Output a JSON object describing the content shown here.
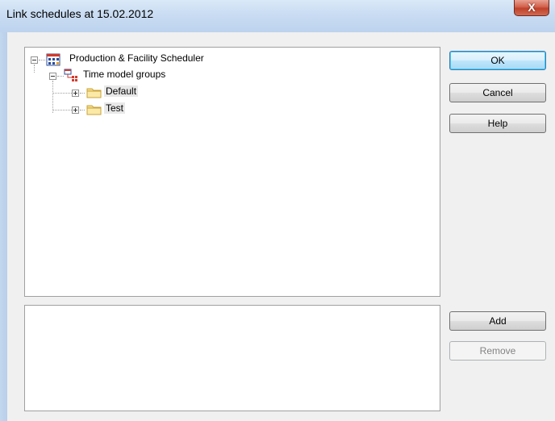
{
  "window": {
    "title": "Link schedules at 15.02.2012",
    "close_glyph": "X"
  },
  "tree": {
    "root": {
      "label": "Production & Facility Scheduler",
      "icon": "scheduler-app-icon",
      "expanded": true
    },
    "group": {
      "label": "Time model groups",
      "icon": "time-model-groups-icon",
      "expanded": true
    },
    "children": [
      {
        "label": "Default",
        "icon": "folder-icon",
        "expanded": false
      },
      {
        "label": "Test",
        "icon": "folder-icon",
        "expanded": false
      }
    ]
  },
  "buttons": {
    "ok": "OK",
    "cancel": "Cancel",
    "help": "Help",
    "add": "Add",
    "remove": "Remove"
  },
  "colors": {
    "default_button_border": "#3c7fb1",
    "close_button": "#c0412b",
    "disabled_text": "#838383"
  }
}
